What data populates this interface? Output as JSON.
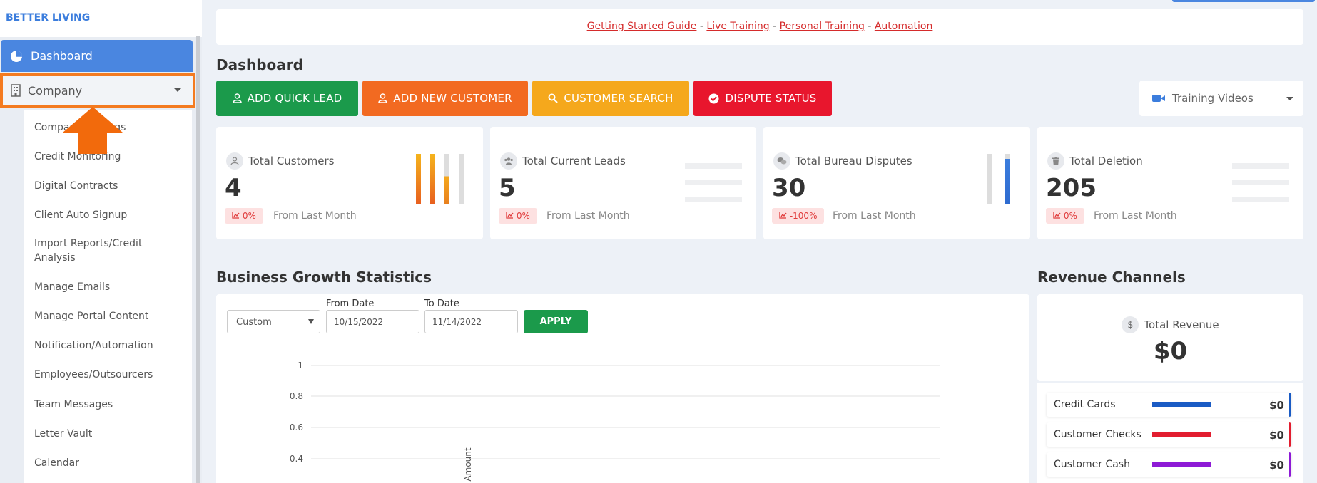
{
  "brand": "BETTER LIVING",
  "sidebar": {
    "dashboard": "Dashboard",
    "company": "Company",
    "submenu": [
      "Company Settings",
      "Credit Monitoring",
      "Digital Contracts",
      "Client Auto Signup",
      "Import Reports/Credit Analysis",
      "Manage Emails",
      "Manage Portal Content",
      "Notification/Automation",
      "Employees/Outsourcers",
      "Team Messages",
      "Letter Vault",
      "Calendar"
    ]
  },
  "toplinks": {
    "guide": "Getting Started Guide",
    "live": "Live Training",
    "personal": "Personal Training",
    "automation": "Automation",
    "sep": "-"
  },
  "page_title": "Dashboard",
  "actions": {
    "add_quick_lead": "ADD QUICK LEAD",
    "add_new_customer": "ADD NEW CUSTOMER",
    "customer_search": "CUSTOMER SEARCH",
    "dispute_status": "DISPUTE STATUS",
    "training_videos": "Training Videos"
  },
  "stats": [
    {
      "label": "Total Customers",
      "value": "4",
      "change": "0%",
      "note": "From Last Month"
    },
    {
      "label": "Total Current Leads",
      "value": "5",
      "change": "0%",
      "note": "From Last Month"
    },
    {
      "label": "Total Bureau Disputes",
      "value": "30",
      "change": "-100%",
      "note": "From Last Month"
    },
    {
      "label": "Total Deletion",
      "value": "205",
      "change": "0%",
      "note": "From Last Month"
    }
  ],
  "growth": {
    "title": "Business Growth Statistics",
    "range_select": "Custom",
    "from_label": "From Date",
    "from_value": "10/15/2022",
    "to_label": "To Date",
    "to_value": "11/14/2022",
    "apply": "APPLY",
    "ylabel": "Amount",
    "yticks": [
      "1",
      "0.8",
      "0.6",
      "0.4"
    ]
  },
  "revenue": {
    "title": "Revenue Channels",
    "total_label": "Total Revenue",
    "total_value": "$0",
    "channels": [
      {
        "name": "Credit Cards",
        "amount": "$0",
        "color": "#1a5bc4"
      },
      {
        "name": "Customer Checks",
        "amount": "$0",
        "color": "#e21d2f"
      },
      {
        "name": "Customer Cash",
        "amount": "$0",
        "color": "#8e1ad6"
      }
    ]
  },
  "colors": {
    "green": "#1b9a4b",
    "orange": "#f26a21",
    "yellow": "#f5a81c",
    "red": "#e8162d",
    "blue": "#4a86e0",
    "highlight": "#f47b20"
  }
}
